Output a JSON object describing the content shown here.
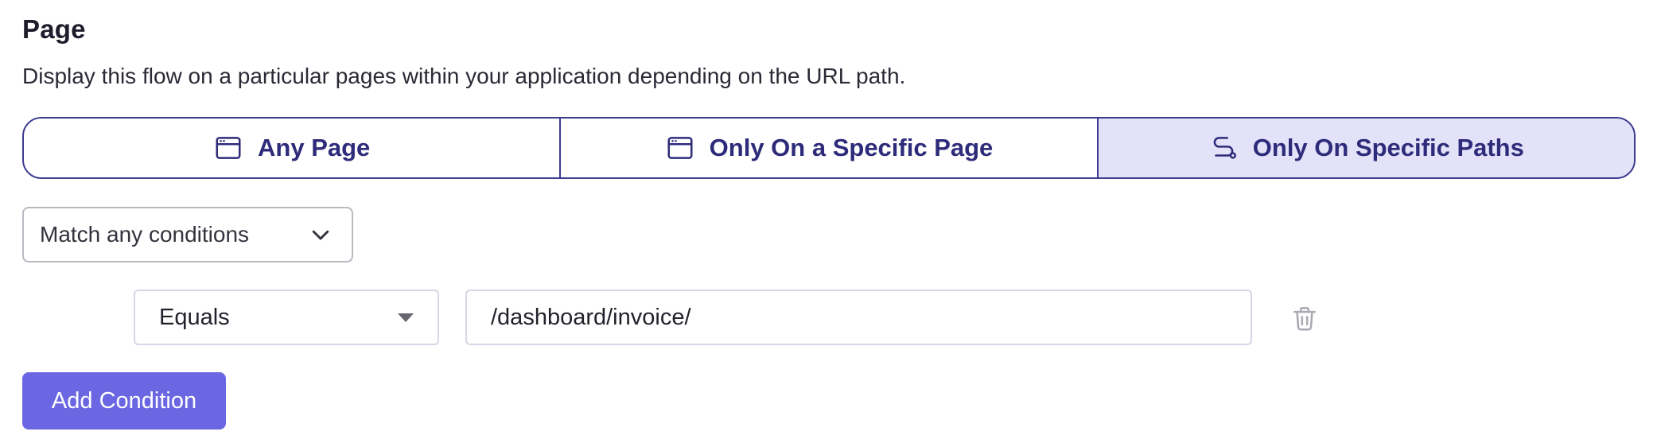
{
  "section": {
    "title": "Page",
    "description": "Display this flow on a particular pages within your application depending on the URL path."
  },
  "page_options": {
    "selected_index": 2,
    "items": [
      {
        "label": "Any Page",
        "icon": "browser-window-icon"
      },
      {
        "label": "Only On a Specific Page",
        "icon": "browser-window-icon"
      },
      {
        "label": "Only On Specific Paths",
        "icon": "route-path-icon"
      }
    ]
  },
  "match_select": {
    "value": "Match any conditions",
    "icon": "chevron-down-icon"
  },
  "condition": {
    "operator": "Equals",
    "value": "/dashboard/invoice/",
    "delete_icon": "trash-icon"
  },
  "add_condition_label": "Add Condition",
  "colors": {
    "accent": "#6b67e3",
    "segment_border": "#3d3a8f",
    "segment_active_bg": "#e3e2f9",
    "segment_text": "#2e2b7a"
  }
}
